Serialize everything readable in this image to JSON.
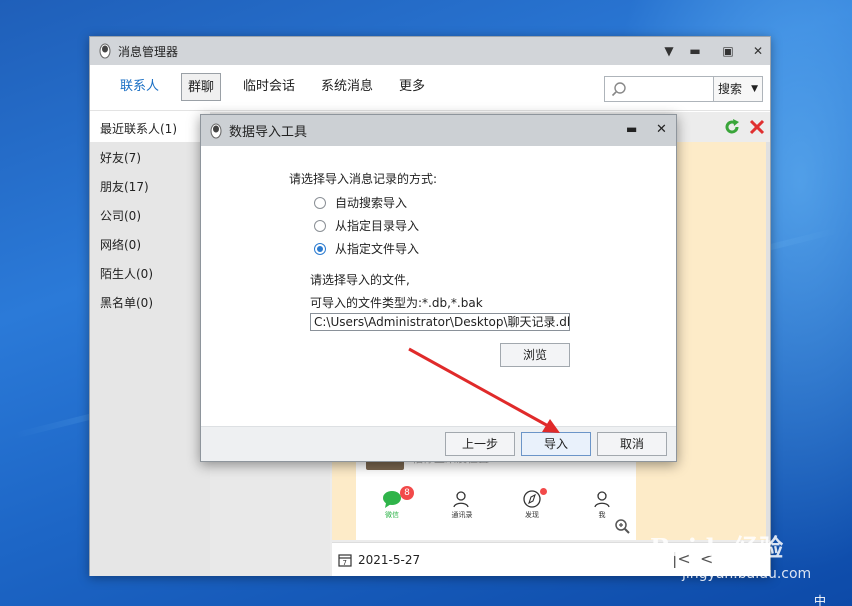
{
  "main_window": {
    "title": "消息管理器",
    "tabs": [
      {
        "label": "联系人"
      },
      {
        "label": "群聊"
      },
      {
        "label": "临时会话"
      },
      {
        "label": "系统消息"
      },
      {
        "label": "更多"
      }
    ],
    "search": {
      "value": "",
      "button_label": "搜索"
    },
    "sidebar": [
      {
        "label": "最近联系人(1)"
      },
      {
        "label": "好友(7)"
      },
      {
        "label": "朋友(17)"
      },
      {
        "label": "公司(0)"
      },
      {
        "label": "网络(0)"
      },
      {
        "label": "陌生人(0)"
      },
      {
        "label": "黑名单(0)"
      }
    ],
    "date": "2021-5-27",
    "preview": {
      "message": "怕你上来没位置",
      "nav": [
        {
          "label": "微信",
          "badge": "8"
        },
        {
          "label": "通讯录",
          "badge": ""
        },
        {
          "label": "发现",
          "badge": ""
        },
        {
          "label": "我",
          "badge": ""
        }
      ]
    }
  },
  "dialog": {
    "title": "数据导入工具",
    "prompt": "请选择导入消息记录的方式:",
    "options": [
      {
        "label": "自动搜索导入",
        "checked": false
      },
      {
        "label": "从指定目录导入",
        "checked": false
      },
      {
        "label": "从指定文件导入",
        "checked": true
      }
    ],
    "file_prompt": "请选择导入的文件,",
    "file_types": "可导入的文件类型为:*.db,*.bak",
    "file_path": "C:\\Users\\Administrator\\Desktop\\聊天记录.db",
    "browse_label": "浏览",
    "prev_label": "上一步",
    "import_label": "导入",
    "cancel_label": "取消"
  },
  "watermark": {
    "line1": "Baidu经验",
    "line2": "jingyan.baidu.com"
  },
  "taskbar": {
    "ime": "中"
  },
  "colors": {
    "accent": "#1a6fc4",
    "annotation_arrow": "#e02a2a",
    "preview_bg": "#fdebc8"
  }
}
